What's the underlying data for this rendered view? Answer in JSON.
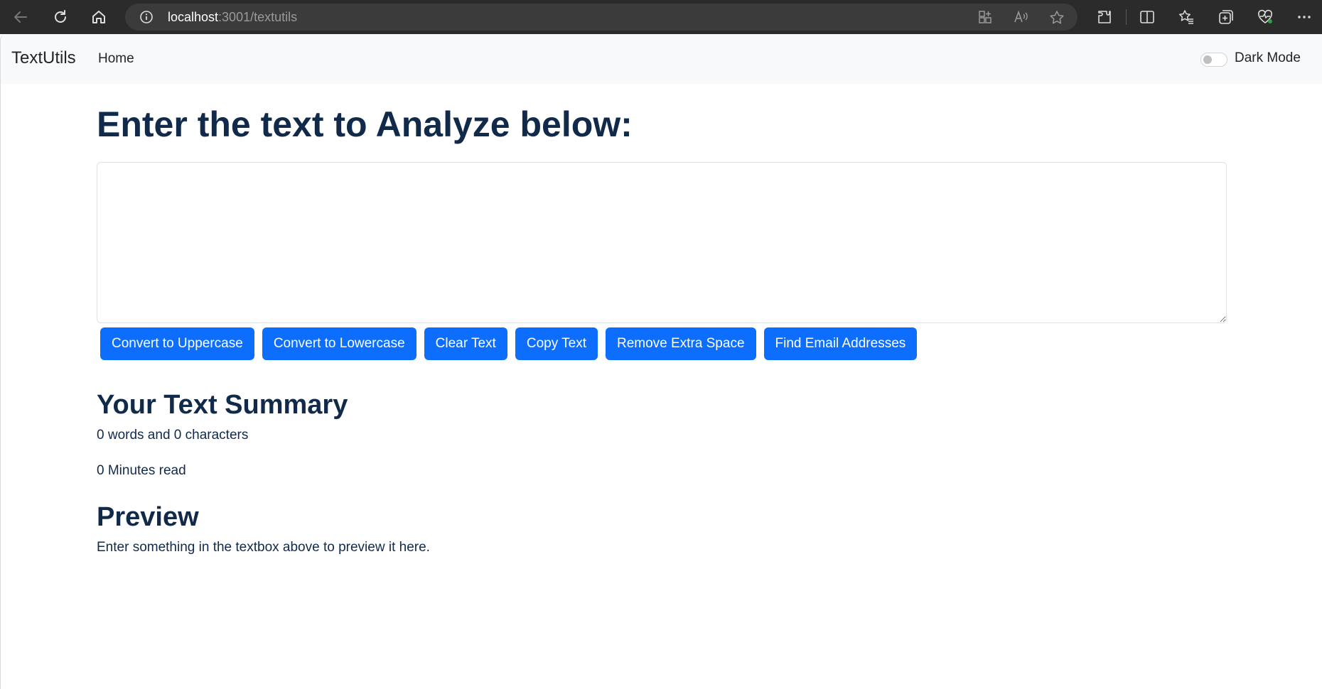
{
  "browser": {
    "url_host": "localhost",
    "url_path": ":3001/textutils"
  },
  "navbar": {
    "brand": "TextUtils",
    "home_link": "Home",
    "dark_mode_label": "Dark Mode",
    "dark_mode_enabled": false
  },
  "main": {
    "heading": "Enter the text to Analyze below:",
    "textarea_value": "",
    "buttons": {
      "uppercase": "Convert to Uppercase",
      "lowercase": "Convert to Lowercase",
      "clear": "Clear Text",
      "copy": "Copy Text",
      "remove_space": "Remove Extra Space",
      "find_email": "Find Email Addresses"
    },
    "summary_heading": "Your Text Summary",
    "word_char_count": "0 words and 0 characters",
    "read_time": "0 Minutes read",
    "preview_heading": "Preview",
    "preview_text": "Enter something in the textbox above to preview it here."
  },
  "colors": {
    "primary": "#0d6efd",
    "heading": "#112a4a",
    "navbar_bg": "#f8f9fa",
    "chrome_bg": "#2b2b2b"
  }
}
